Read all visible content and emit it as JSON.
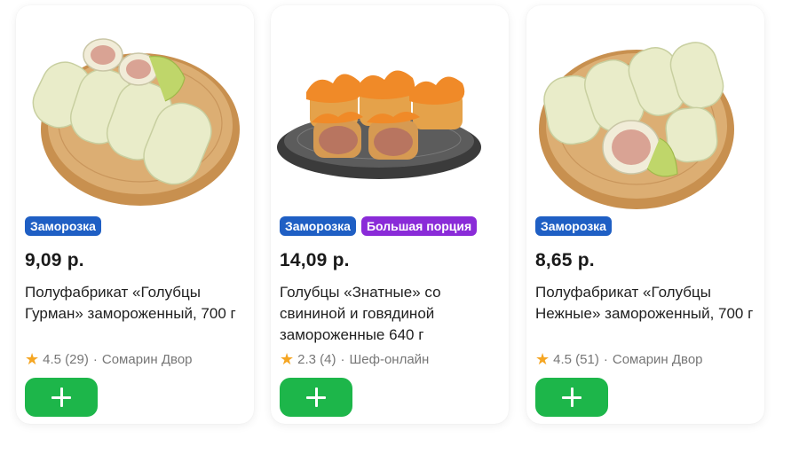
{
  "products": [
    {
      "image": "cabbage-rolls-on-board-image",
      "badges": [
        {
          "label": "Заморозка",
          "color": "#1f5fc4"
        }
      ],
      "price": "9,09 р.",
      "title": "Полуфабрикат «Голубцы Гурман» замороженный, 700 г",
      "rating": "4.5",
      "reviews": "(29)",
      "separator": "·",
      "seller": "Сомарин Двор"
    },
    {
      "image": "cabbage-rolls-with-sauce-image",
      "badges": [
        {
          "label": "Заморозка",
          "color": "#1f5fc4"
        },
        {
          "label": "Большая порция",
          "color": "#8a2bd8"
        }
      ],
      "price": "14,09 р.",
      "title": "Голубцы «Знатные» со свининой и говядиной замороженные 640 г",
      "rating": "2.3",
      "reviews": "(4)",
      "separator": "·",
      "seller": "Шеф-онлайн"
    },
    {
      "image": "cabbage-rolls-on-board-image",
      "badges": [
        {
          "label": "Заморозка",
          "color": "#1f5fc4"
        }
      ],
      "price": "8,65 р.",
      "title": "Полуфабрикат «Голубцы Нежные» замороженный, 700 г",
      "rating": "4.5",
      "reviews": "(51)",
      "separator": "·",
      "seller": "Сомарин Двор"
    }
  ],
  "icons": {
    "rating": "star-icon",
    "add": "plus-icon"
  },
  "colors": {
    "add_button": "#1db64a",
    "star": "#f5a623"
  }
}
